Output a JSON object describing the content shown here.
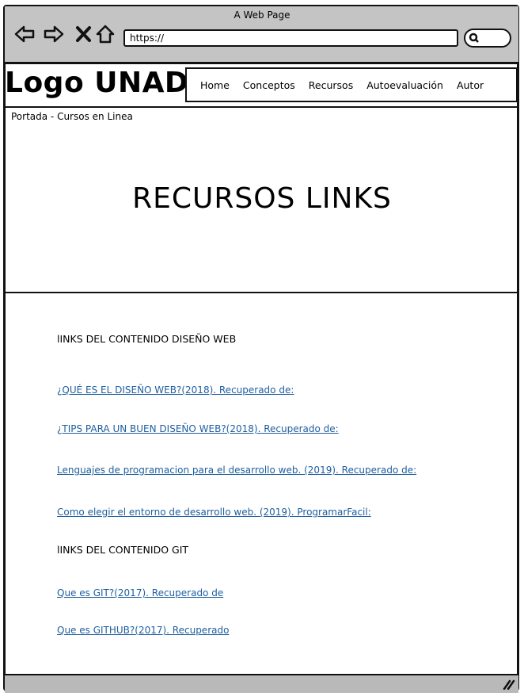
{
  "window": {
    "title": "A Web Page",
    "url": "https://",
    "icons": [
      "back-arrow-icon",
      "forward-arrow-icon",
      "close-x-icon",
      "home-icon",
      "search-icon",
      "resize-grip-icon"
    ]
  },
  "header": {
    "logo": "Logo UNAD",
    "menu": [
      "Home",
      "Conceptos",
      "Recursos",
      "Autoevaluación",
      "Autor"
    ]
  },
  "hero": {
    "breadcrumb": "Portada - Cursos en Linea",
    "title": "RECURSOS LINKS"
  },
  "content": {
    "section1_title": "lINKS DEL CONTENIDO DISEÑO WEB",
    "section1_links": [
      "¿QUÉ ES EL DISEÑO WEB?(2018). Recuperado de:",
      " ¿TIPS PARA UN BUEN DISEÑO WEB?(2018). Recuperado de:",
      " Lenguajes de programacion para el desarrollo web. (2019). Recuperado de:",
      " Como elegir el entorno de desarrollo web. (2019). ProgramarFacil:"
    ],
    "section2_title": "lINKS DEL CONTENIDO GIT",
    "section2_links": [
      " Que es GIT?(2017). Recuperado de",
      " Que es GITHUB?(2017). Recuperado"
    ]
  },
  "colors": {
    "chrome": "#c4c4c4",
    "link": "#1f5fa0",
    "footer": "#b9b9b9"
  }
}
